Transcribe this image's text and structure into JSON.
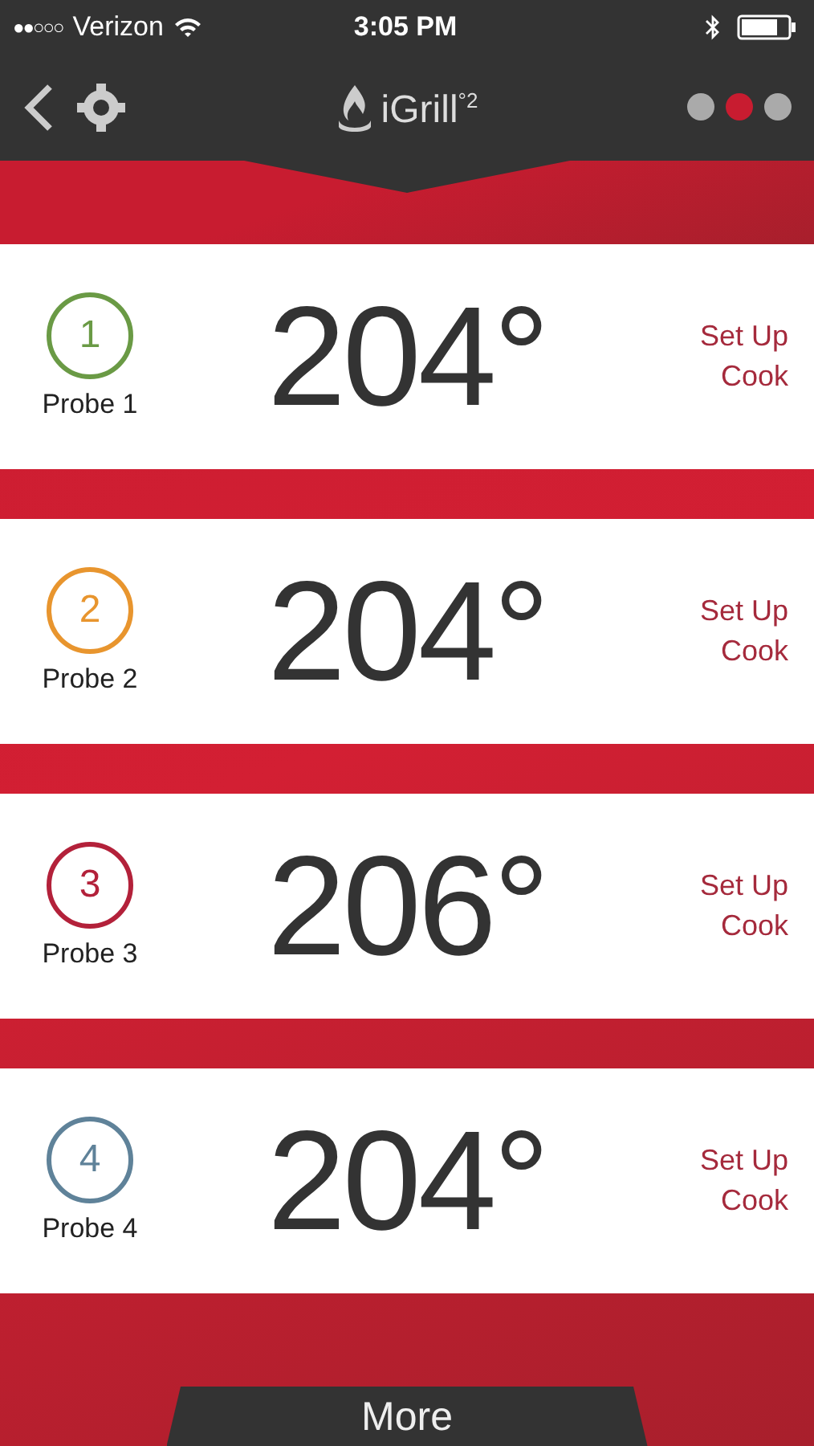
{
  "status_bar": {
    "signal": "●●○○○",
    "carrier": "Verizon",
    "time": "3:05 PM"
  },
  "nav": {
    "logo": "iGrill$^{°2}$",
    "pages": [
      {
        "selected": false
      },
      {
        "selected": true
      },
      {
        "selected": false
      }
    ]
  },
  "probes": [
    {
      "number": "1",
      "name": "Probe 1",
      "temperature": "204°",
      "action": "Set Up Cook",
      "color": "#6a9a45"
    },
    {
      "number": "2",
      "name": "Probe 2",
      "temperature": "204°",
      "action": "Set Up Cook",
      "color": "#e8952e"
    },
    {
      "number": "3",
      "name": "Probe 3",
      "temperature": "206°",
      "action": "Set Up Cook",
      "color": "#b3213a"
    },
    {
      "number": "4",
      "name": "Probe 4",
      "temperature": "204°",
      "action": "Set Up Cook",
      "color": "#5f8299"
    }
  ],
  "more_button": "More"
}
